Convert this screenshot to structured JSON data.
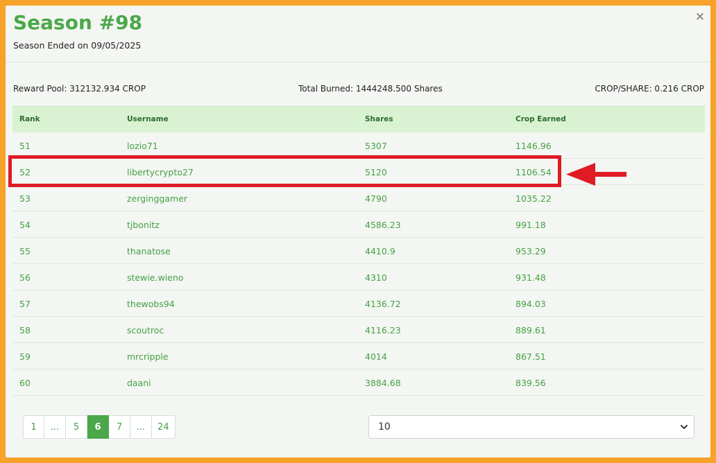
{
  "header": {
    "title": "Season #98",
    "subtitle": "Season Ended on 09/05/2025",
    "close_glyph": "×"
  },
  "stats": {
    "reward_pool": "Reward Pool: 312132.934 CROP",
    "total_burned": "Total Burned: 1444248.500 Shares",
    "crop_per_share": "CROP/SHARE: 0.216 CROP"
  },
  "table": {
    "headers": [
      "Rank",
      "Username",
      "Shares",
      "Crop Earned"
    ],
    "rows": [
      [
        "51",
        "lozio71",
        "5307",
        "1146.96"
      ],
      [
        "52",
        "libertycrypto27",
        "5120",
        "1106.54"
      ],
      [
        "53",
        "zerginggamer",
        "4790",
        "1035.22"
      ],
      [
        "54",
        "tjbonitz",
        "4586.23",
        "991.18"
      ],
      [
        "55",
        "thanatose",
        "4410.9",
        "953.29"
      ],
      [
        "56",
        "stewie.wieno",
        "4310",
        "931.48"
      ],
      [
        "57",
        "thewobs94",
        "4136.72",
        "894.03"
      ],
      [
        "58",
        "scoutroc",
        "4116.23",
        "889.61"
      ],
      [
        "59",
        "mrcripple",
        "4014",
        "867.51"
      ],
      [
        "60",
        "daani",
        "3884.68",
        "839.56"
      ]
    ]
  },
  "pagination": {
    "pages": [
      "1",
      "...",
      "5",
      "6",
      "7",
      "...",
      "24"
    ],
    "active": "6"
  },
  "page_size": {
    "selected": "10"
  },
  "colors": {
    "accent": "#4aa84a",
    "highlight": "#e01b24",
    "frame": "#f7a22a",
    "header_bg": "#d9f3d2"
  }
}
